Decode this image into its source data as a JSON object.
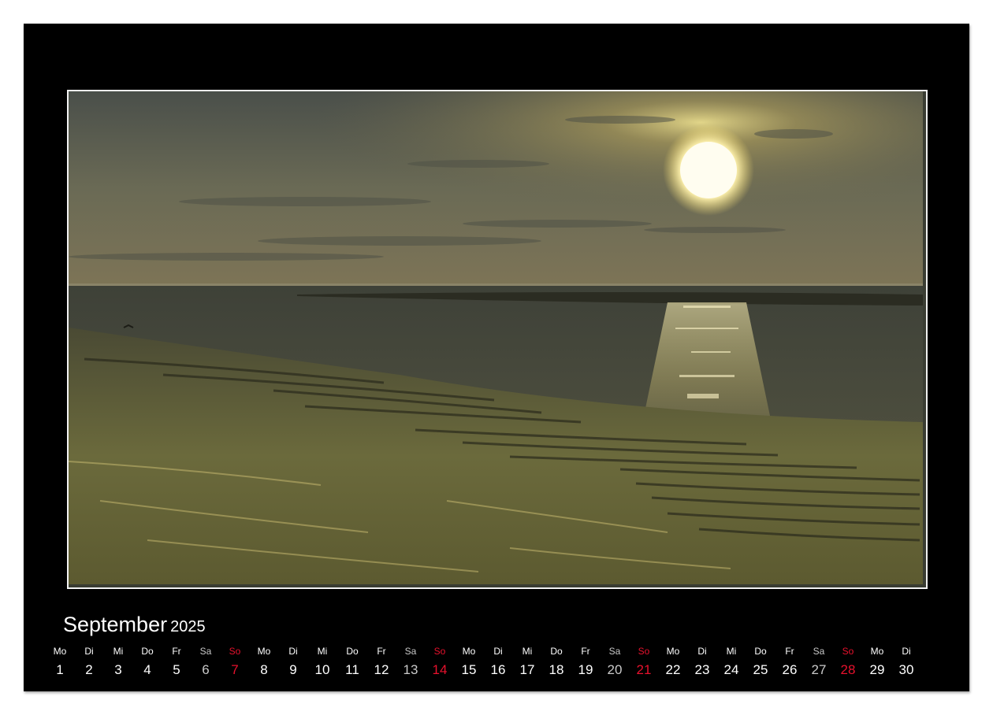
{
  "calendar": {
    "month": "September",
    "year": "2025",
    "weekdays": [
      "Mo",
      "Di",
      "Mi",
      "Do",
      "Fr",
      "Sa",
      "So",
      "Mo",
      "Di",
      "Mi",
      "Do",
      "Fr",
      "Sa",
      "So",
      "Mo",
      "Di",
      "Mi",
      "Do",
      "Fr",
      "Sa",
      "So",
      "Mo",
      "Di",
      "Mi",
      "Do",
      "Fr",
      "Sa",
      "So",
      "Mo",
      "Di"
    ],
    "days": [
      "1",
      "2",
      "3",
      "4",
      "5",
      "6",
      "7",
      "8",
      "9",
      "10",
      "11",
      "12",
      "13",
      "14",
      "15",
      "16",
      "17",
      "18",
      "19",
      "20",
      "21",
      "22",
      "23",
      "24",
      "25",
      "26",
      "27",
      "28",
      "29",
      "30"
    ],
    "sunday_color": "#e8112d",
    "saturday_color": "#c9c9c9"
  },
  "photo": {
    "subject": "sun-over-tidal-flat"
  }
}
